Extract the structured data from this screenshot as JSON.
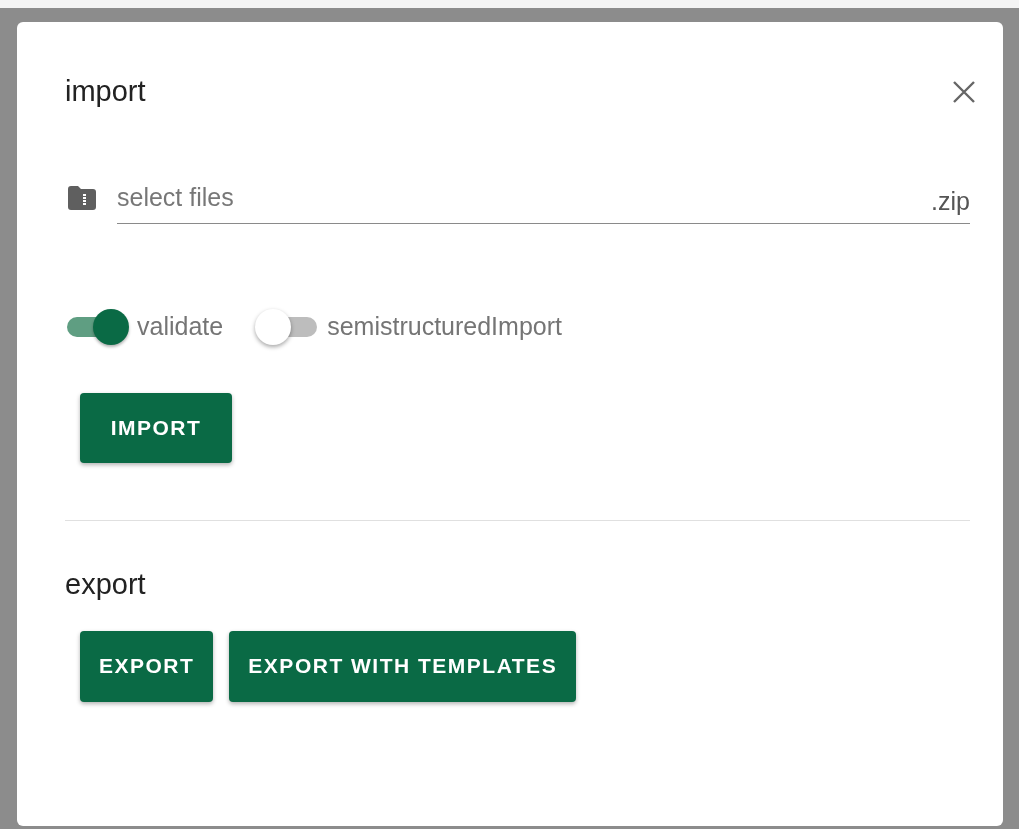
{
  "import_section": {
    "title": "import",
    "file_field": {
      "placeholder": "select files",
      "suffix": ".zip"
    },
    "switches": [
      {
        "label": "validate",
        "on": true
      },
      {
        "label": "semistructuredImport",
        "on": false
      }
    ],
    "button": "IMPORT"
  },
  "export_section": {
    "title": "export",
    "buttons": [
      "EXPORT",
      "EXPORT WITH TEMPLATES"
    ]
  }
}
